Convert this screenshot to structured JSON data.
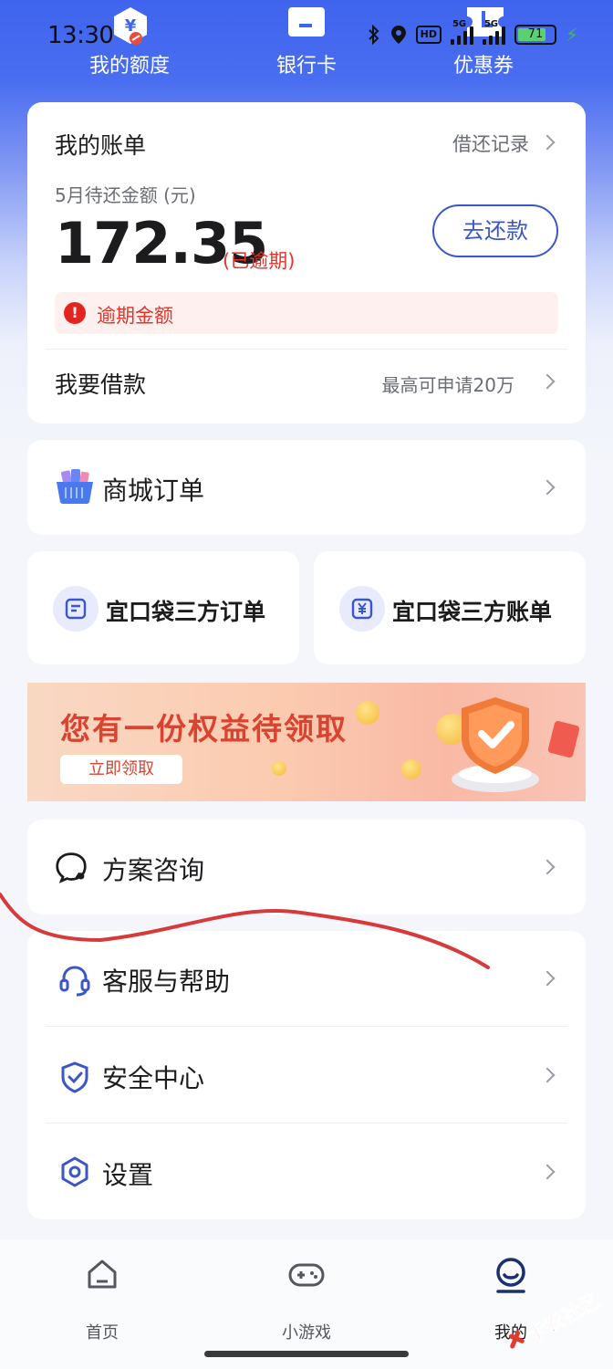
{
  "status_bar": {
    "time": "13:30",
    "hd": "HD",
    "net1": "5G",
    "net2": "5G",
    "battery": "71"
  },
  "top_nav": {
    "items": [
      "我的额度",
      "银行卡",
      "优惠券"
    ]
  },
  "bill_card": {
    "title": "我的账单",
    "history_link": "借还记录",
    "subtitle": "5月待还金额 (元)",
    "amount": "172.35",
    "overdue_tag": "(已逾期)",
    "repay_button": "去还款",
    "overdue_notice": "逾期金额",
    "loan_label": "我要借款",
    "loan_hint": "最高可申请20万"
  },
  "mall_orders": {
    "label": "商城订单"
  },
  "third_party": {
    "orders": "宜口袋三方订单",
    "bills": "宜口袋三方账单"
  },
  "banner": {
    "title": "您有一份权益待领取",
    "button": "立即领取"
  },
  "plan_consult": {
    "label": "方案咨询"
  },
  "menu": {
    "items": [
      "客服与帮助",
      "安全中心",
      "设置"
    ]
  },
  "tabbar": {
    "tabs": [
      "首页",
      "小游戏",
      "我的"
    ]
  },
  "watermark": {
    "text": "卡农社区"
  },
  "colors": {
    "primary": "#3a56c8",
    "danger": "#e0352b",
    "header_blue": "#3f64ee"
  }
}
